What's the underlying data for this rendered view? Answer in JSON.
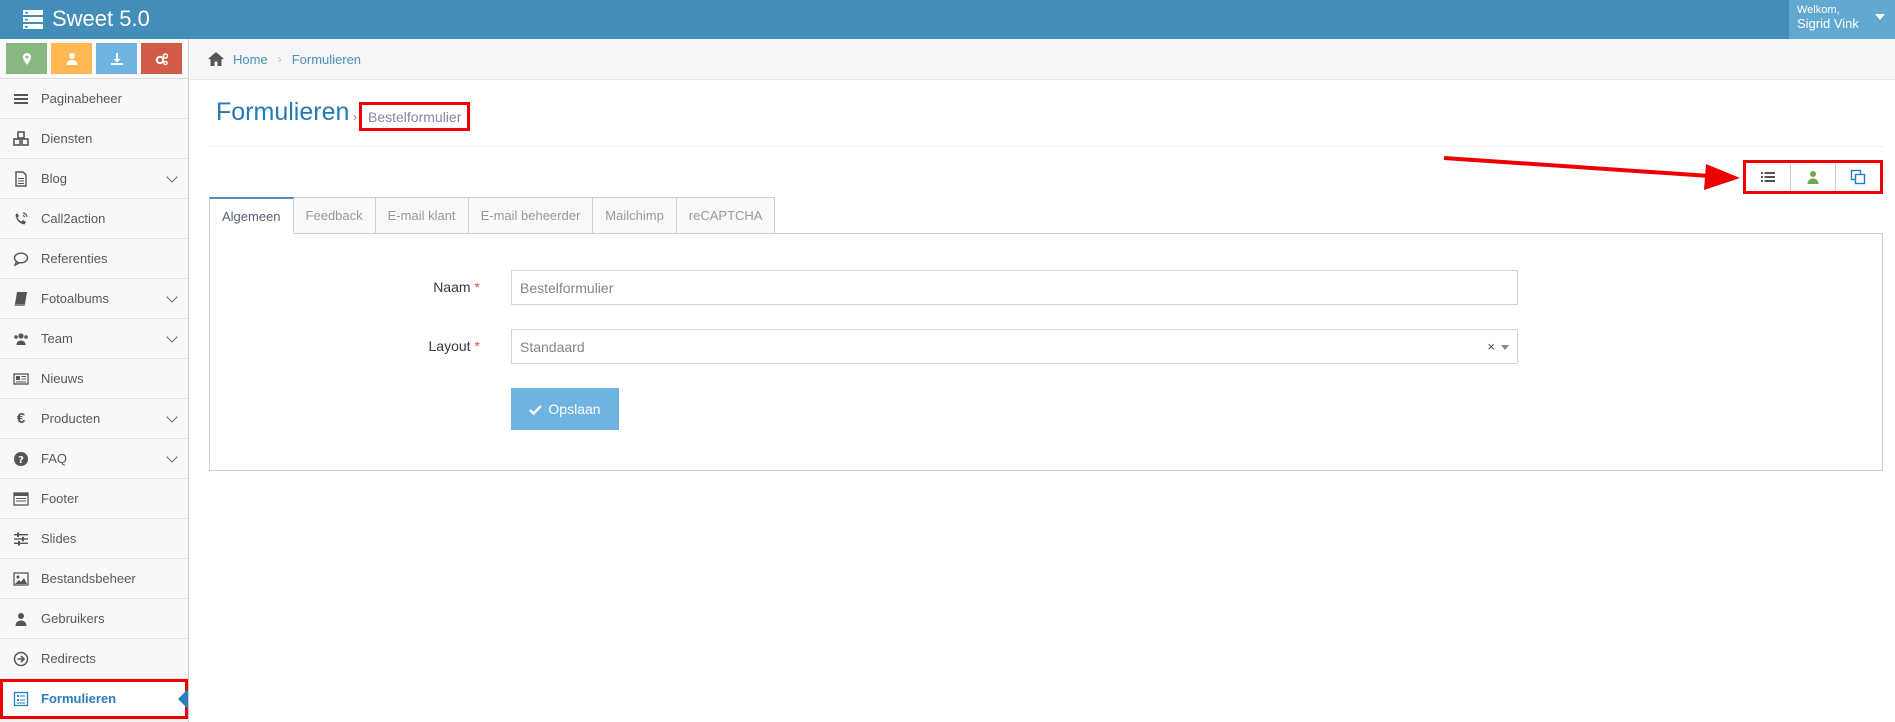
{
  "app": {
    "title": "Sweet 5.0"
  },
  "user": {
    "welcome": "Welkom,",
    "name": "Sigrid Vink"
  },
  "shortcuts": [
    {
      "icon": "map-marker-icon",
      "color": "#87b87f"
    },
    {
      "icon": "user-icon",
      "color": "#ffb752"
    },
    {
      "icon": "download-icon",
      "color": "#6fb3e0"
    },
    {
      "icon": "cogs-icon",
      "color": "#d15b47"
    }
  ],
  "sidebar": {
    "items": [
      {
        "label": "Paginabeheer",
        "icon": "bars-icon",
        "has_submenu": false
      },
      {
        "label": "Diensten",
        "icon": "cubes-icon",
        "has_submenu": false
      },
      {
        "label": "Blog",
        "icon": "file-text-icon",
        "has_submenu": true
      },
      {
        "label": "Call2action",
        "icon": "phone-volume-icon",
        "has_submenu": false
      },
      {
        "label": "Referenties",
        "icon": "comment-icon",
        "has_submenu": false
      },
      {
        "label": "Fotoalbums",
        "icon": "book-icon",
        "has_submenu": true
      },
      {
        "label": "Team",
        "icon": "users-icon",
        "has_submenu": true
      },
      {
        "label": "Nieuws",
        "icon": "newspaper-icon",
        "has_submenu": false
      },
      {
        "label": "Producten",
        "icon": "euro-icon",
        "has_submenu": true
      },
      {
        "label": "FAQ",
        "icon": "question-circle-icon",
        "has_submenu": true
      },
      {
        "label": "Footer",
        "icon": "list-alt-icon",
        "has_submenu": false
      },
      {
        "label": "Slides",
        "icon": "sliders-icon",
        "has_submenu": false
      },
      {
        "label": "Bestandsbeheer",
        "icon": "image-icon",
        "has_submenu": false
      },
      {
        "label": "Gebruikers",
        "icon": "user-icon",
        "has_submenu": false
      },
      {
        "label": "Redirects",
        "icon": "arrow-circle-right-icon",
        "has_submenu": false
      },
      {
        "label": "Formulieren",
        "icon": "form-icon",
        "has_submenu": false,
        "active": true
      }
    ]
  },
  "breadcrumb": {
    "home": "Home",
    "current": "Formulieren"
  },
  "page": {
    "title": "Formulieren",
    "separator": "›",
    "subtitle": "Bestelformulier"
  },
  "toolbar": [
    {
      "icon": "list-icon",
      "color": "#555555"
    },
    {
      "icon": "user-icon",
      "color": "#69aa46"
    },
    {
      "icon": "copy-icon",
      "color": "#2b7dbc"
    }
  ],
  "tabs": [
    {
      "label": "Algemeen",
      "active": true
    },
    {
      "label": "Feedback"
    },
    {
      "label": "E-mail klant"
    },
    {
      "label": "E-mail beheerder"
    },
    {
      "label": "Mailchimp"
    },
    {
      "label": "reCAPTCHA"
    }
  ],
  "form": {
    "naam": {
      "label": "Naam",
      "required_mark": "*",
      "value": "Bestelformulier"
    },
    "layout": {
      "label": "Layout",
      "required_mark": "*",
      "value": "Standaard",
      "clear": "×"
    },
    "save_label": "Opslaan"
  },
  "colors": {
    "topbar": "#438eb9",
    "accent": "#2679b5",
    "highlight": "#e00000"
  }
}
